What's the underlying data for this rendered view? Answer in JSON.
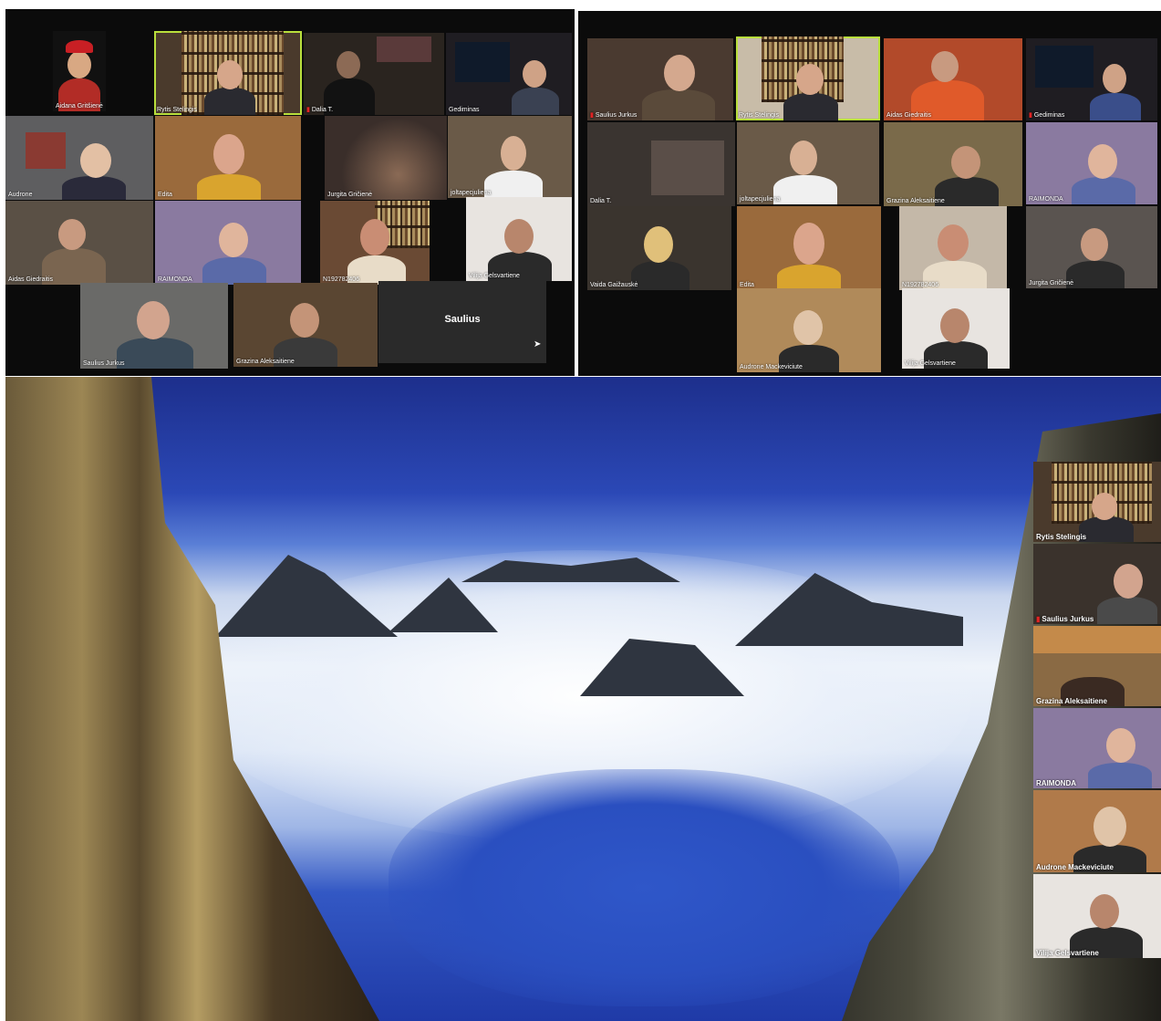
{
  "left_gallery": {
    "participants": [
      {
        "name": "Aidana Gritšienė",
        "mic_muted": false
      },
      {
        "name": "Rytis Stelingis",
        "mic_muted": false,
        "active_speaker": true
      },
      {
        "name": "Dalia T.",
        "mic_muted": true
      },
      {
        "name": "Gediminas",
        "mic_muted": false
      },
      {
        "name": "Audrone",
        "mic_muted": false
      },
      {
        "name": "Edita",
        "mic_muted": false
      },
      {
        "name": "Jurgita Gričienė",
        "mic_muted": false
      },
      {
        "name": "joltapecjuliena",
        "mic_muted": false
      },
      {
        "name": "Aidas Giedraitis",
        "mic_muted": false
      },
      {
        "name": "RAIMONDA",
        "mic_muted": false
      },
      {
        "name": "N192782406",
        "mic_muted": false
      },
      {
        "name": "Vilija Gelsvartiene",
        "mic_muted": false
      },
      {
        "name": "Saulius Jurkus",
        "mic_muted": false
      },
      {
        "name": "Grazina Aleksaitiene",
        "mic_muted": false
      },
      {
        "name": "Saulius",
        "mic_muted": false,
        "video_off": true
      }
    ]
  },
  "right_gallery": {
    "participants": [
      {
        "name": "Saulius Jurkus",
        "mic_muted": true
      },
      {
        "name": "Rytis Stelingis",
        "mic_muted": false,
        "active_speaker": true
      },
      {
        "name": "Aidas Giedraitis",
        "mic_muted": false
      },
      {
        "name": "Gediminas",
        "mic_muted": true
      },
      {
        "name": "Dalia T.",
        "mic_muted": false
      },
      {
        "name": "joltapecjuliena",
        "mic_muted": false
      },
      {
        "name": "Grazina Aleksaitiene",
        "mic_muted": false
      },
      {
        "name": "RAIMONDA",
        "mic_muted": false
      },
      {
        "name": "Vaida Gaižauskė",
        "mic_muted": false
      },
      {
        "name": "Edita",
        "mic_muted": false
      },
      {
        "name": "N192782406",
        "mic_muted": false
      },
      {
        "name": "Jurgita Gričienė",
        "mic_muted": false
      },
      {
        "name": "Audrone Mackeviciute",
        "mic_muted": false
      },
      {
        "name": "Vilija Gelsvartiene",
        "mic_muted": false
      }
    ]
  },
  "screen_share": {
    "participants": [
      {
        "name": "Rytis Stelingis",
        "mic_muted": false
      },
      {
        "name": "Saulius Jurkus",
        "mic_muted": true
      },
      {
        "name": "Grazina Aleksaitiene",
        "mic_muted": false
      },
      {
        "name": "RAIMONDA",
        "mic_muted": false
      },
      {
        "name": "Audrone Mackeviciute",
        "mic_muted": false
      },
      {
        "name": "Vilija Gelsvartiene",
        "mic_muted": false
      }
    ]
  },
  "colors": {
    "active_speaker_border": "#b9df3c",
    "muted_mic": "#e02424",
    "panel_bg": "#0b0b0b"
  }
}
